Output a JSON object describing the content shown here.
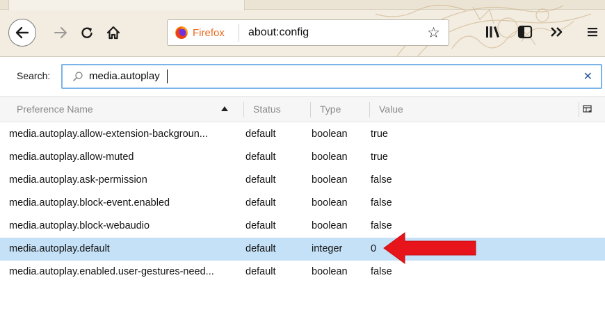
{
  "browser": {
    "identity_label": "Firefox",
    "url": "about:config",
    "icons": [
      "back-icon",
      "forward-icon",
      "reload-icon",
      "home-icon",
      "firefox-logo-icon",
      "bookmark-star-icon",
      "library-icon",
      "sidebar-icon",
      "overflow-menu-icon",
      "hamburger-menu-icon"
    ]
  },
  "search": {
    "label": "Search:",
    "value": "media.autoplay"
  },
  "table": {
    "columns": {
      "name": "Preference Name",
      "status": "Status",
      "type": "Type",
      "value": "Value"
    },
    "rows": [
      {
        "name": "media.autoplay.allow-extension-backgroun...",
        "status": "default",
        "type": "boolean",
        "value": "true"
      },
      {
        "name": "media.autoplay.allow-muted",
        "status": "default",
        "type": "boolean",
        "value": "true"
      },
      {
        "name": "media.autoplay.ask-permission",
        "status": "default",
        "type": "boolean",
        "value": "false"
      },
      {
        "name": "media.autoplay.block-event.enabled",
        "status": "default",
        "type": "boolean",
        "value": "false"
      },
      {
        "name": "media.autoplay.block-webaudio",
        "status": "default",
        "type": "boolean",
        "value": "false"
      },
      {
        "name": "media.autoplay.default",
        "status": "default",
        "type": "integer",
        "value": "0"
      },
      {
        "name": "media.autoplay.enabled.user-gestures-need...",
        "status": "default",
        "type": "boolean",
        "value": "false"
      }
    ]
  },
  "colors": {
    "selected_row": "#c5e1f7",
    "annotation_arrow": "#e8141b",
    "search_focus": "#7ab3e8",
    "firefox_orange": "#ea6a1f"
  }
}
